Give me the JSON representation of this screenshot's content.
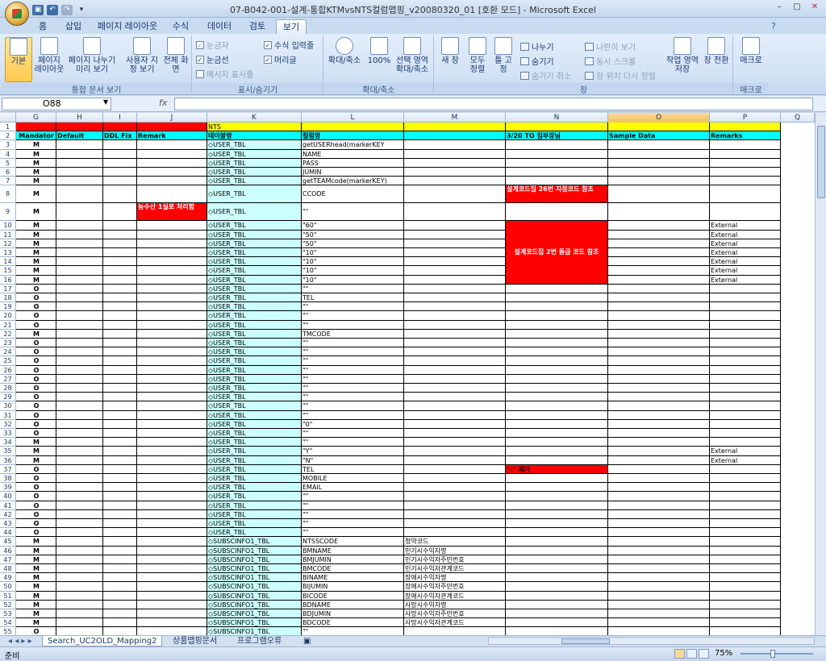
{
  "window": {
    "title": "07-B042-001-설계-통합KTMvsNTS컬럼맵핑_v20080320_01  [호환 모드] - Microsoft Excel",
    "controls": [
      "–",
      "□",
      "✕"
    ]
  },
  "tabs": [
    "홈",
    "삽입",
    "페이지 레이아웃",
    "수식",
    "데이터",
    "검토",
    "보기"
  ],
  "active_tab": "보기",
  "ribbon": {
    "groups": [
      {
        "label": "통합 문서 보기",
        "buttons": [
          "기본",
          "페이지 레이아웃",
          "페이지 나누기 미리 보기",
          "사용자 지정 보기",
          "전체 화면"
        ]
      },
      {
        "label": "표시/숨기기",
        "checks": [
          {
            "label": "눈금자",
            "checked": true,
            "disabled": true
          },
          {
            "label": "수식 입력줄",
            "checked": true,
            "disabled": false
          },
          {
            "label": "눈금선",
            "checked": true,
            "disabled": false
          },
          {
            "label": "머리글",
            "checked": true,
            "disabled": false
          },
          {
            "label": "메시지 표시줄",
            "checked": false,
            "disabled": true
          }
        ]
      },
      {
        "label": "확대/축소",
        "buttons": [
          "확대/축소",
          "100%",
          "선택 영역 확대/축소"
        ]
      },
      {
        "label": "창",
        "buttons": [
          "새 창",
          "모두 정렬",
          "틀 고정"
        ],
        "small": [
          {
            "label": "나누기",
            "disabled": false
          },
          {
            "label": "숨기기",
            "disabled": false
          },
          {
            "label": "숨기기 취소",
            "disabled": true
          },
          {
            "label": "나란히 보기",
            "disabled": true
          },
          {
            "label": "동시 스크롤",
            "disabled": true
          },
          {
            "label": "창 위치 다시 정렬",
            "disabled": true
          }
        ],
        "buttons2": [
          "작업 영역 저장",
          "창 전환"
        ]
      },
      {
        "label": "매크로",
        "buttons": [
          "매크로"
        ]
      }
    ]
  },
  "formula_bar": {
    "name_box": "O88",
    "fx": "fx",
    "value": ""
  },
  "columns": [
    {
      "id": "G",
      "selected": false
    },
    {
      "id": "H",
      "selected": false
    },
    {
      "id": "I",
      "selected": false
    },
    {
      "id": "J",
      "selected": false
    },
    {
      "id": "K",
      "selected": false
    },
    {
      "id": "L",
      "selected": false
    },
    {
      "id": "M",
      "selected": false
    },
    {
      "id": "N",
      "selected": false
    },
    {
      "id": "O",
      "selected": true
    },
    {
      "id": "P",
      "selected": false
    },
    {
      "id": "Q",
      "selected": false
    }
  ],
  "rows": [
    {
      "n": "1",
      "K": "NTS"
    },
    {
      "n": "2",
      "G": "Mandator",
      "H": "Default",
      "I": "DDL Fix",
      "J": "Remark",
      "K": "테이블명",
      "L": "컬럼명",
      "M": "",
      "N": "3/20 TO 임부장님",
      "O": "Sample Data",
      "P": "Remarks"
    },
    {
      "n": "3",
      "G": "M",
      "K": "◇USER_TBL",
      "L": "getUSERhead(markerKEY"
    },
    {
      "n": "4",
      "G": "M",
      "K": "◇USER_TBL",
      "L": "NAME"
    },
    {
      "n": "5",
      "G": "M",
      "K": "◇USER_TBL",
      "L": "PASS"
    },
    {
      "n": "6",
      "G": "M",
      "K": "◇USER_TBL",
      "L": "JUMIN"
    },
    {
      "n": "7",
      "G": "M",
      "K": "◇USER_TBL",
      "L": "getTEAMcode(markerKEY)"
    },
    {
      "n": "8",
      "G": "M",
      "K": "◇USER_TBL",
      "L": "CCODE",
      "N": "설계코드집 26번 지점코드 참조"
    },
    {
      "n": "9",
      "G": "M",
      "J": "농수산 1실로 처리함",
      "K": "◇USER_TBL",
      "L": "\"\""
    },
    {
      "n": "10",
      "G": "M",
      "K": "◇USER_TBL",
      "L": "\"60\"",
      "P": "External"
    },
    {
      "n": "11",
      "G": "M",
      "K": "◇USER_TBL",
      "L": "\"50\"",
      "P": "External"
    },
    {
      "n": "12",
      "G": "M",
      "K": "◇USER_TBL",
      "L": "\"50\"",
      "P": "External"
    },
    {
      "n": "13",
      "G": "M",
      "K": "◇USER_TBL",
      "L": "\"10\"",
      "P": "External"
    },
    {
      "n": "14",
      "G": "M",
      "K": "◇USER_TBL",
      "L": "\"10\"",
      "P": "External"
    },
    {
      "n": "15",
      "G": "M",
      "K": "◇USER_TBL",
      "L": "\"10\"",
      "P": "External"
    },
    {
      "n": "16",
      "G": "M",
      "K": "◇USER_TBL",
      "L": "\"10\"",
      "P": "External"
    },
    {
      "n": "17",
      "G": "O",
      "K": "◇USER_TBL",
      "L": "\"\""
    },
    {
      "n": "18",
      "G": "O",
      "K": "◇USER_TBL",
      "L": "TEL"
    },
    {
      "n": "19",
      "G": "O",
      "K": "◇USER_TBL",
      "L": "\"\""
    },
    {
      "n": "20",
      "G": "O",
      "K": "◇USER_TBL",
      "L": "\"\""
    },
    {
      "n": "21",
      "G": "O",
      "K": "◇USER_TBL",
      "L": "\"\""
    },
    {
      "n": "22",
      "G": "M",
      "K": "◇USER_TBL",
      "L": "TMCODE"
    },
    {
      "n": "23",
      "G": "O",
      "K": "◇USER_TBL",
      "L": "\"\""
    },
    {
      "n": "24",
      "G": "O",
      "K": "◇USER_TBL",
      "L": "\"\""
    },
    {
      "n": "25",
      "G": "O",
      "K": "◇USER_TBL",
      "L": "\"\""
    },
    {
      "n": "26",
      "G": "O",
      "K": "◇USER_TBL",
      "L": "\"\""
    },
    {
      "n": "27",
      "G": "O",
      "K": "◇USER_TBL",
      "L": "\"\""
    },
    {
      "n": "28",
      "G": "O",
      "K": "◇USER_TBL",
      "L": "\"\""
    },
    {
      "n": "29",
      "G": "O",
      "K": "◇USER_TBL",
      "L": "\"\""
    },
    {
      "n": "30",
      "G": "O",
      "K": "◇USER_TBL",
      "L": "\"\""
    },
    {
      "n": "31",
      "G": "O",
      "K": "◇USER_TBL",
      "L": "\"\""
    },
    {
      "n": "32",
      "G": "O",
      "K": "◇USER_TBL",
      "L": "\"0\""
    },
    {
      "n": "33",
      "G": "O",
      "K": "◇USER_TBL",
      "L": "\"\""
    },
    {
      "n": "34",
      "G": "M",
      "K": "◇USER_TBL",
      "L": "\"\""
    },
    {
      "n": "35",
      "G": "M",
      "K": "◇USER_TBL",
      "L": "\"Y\"",
      "P": "External"
    },
    {
      "n": "36",
      "G": "M",
      "K": "◇USER_TBL",
      "L": "\"N\"",
      "P": "External"
    },
    {
      "n": "37",
      "G": "O",
      "K": "◇USER_TBL",
      "L": "TEL",
      "N": "\"-\" 제거"
    },
    {
      "n": "38",
      "G": "O",
      "K": "◇USER_TBL",
      "L": "MOBILE"
    },
    {
      "n": "39",
      "G": "O",
      "K": "◇USER_TBL",
      "L": "EMAIL"
    },
    {
      "n": "40",
      "G": "O",
      "K": "◇USER_TBL",
      "L": "\"\""
    },
    {
      "n": "41",
      "G": "O",
      "K": "◇USER_TBL",
      "L": "\"\""
    },
    {
      "n": "42",
      "G": "O",
      "K": "◇USER_TBL",
      "L": "\"\""
    },
    {
      "n": "43",
      "G": "O",
      "K": "◇USER_TBL",
      "L": "\"\""
    },
    {
      "n": "44",
      "G": "O",
      "K": "◇USER_TBL",
      "L": "\"\""
    },
    {
      "n": "45",
      "G": "M",
      "K": "◇SUBSCINFO1_TBL",
      "L": "NTSSCODE",
      "M": "청약코드"
    },
    {
      "n": "46",
      "G": "M",
      "K": "◇SUBSCINFO1_TBL",
      "L": "BMNAME",
      "M": "민기시수익자명"
    },
    {
      "n": "47",
      "G": "M",
      "K": "◇SUBSCINFO1_TBL",
      "L": "BMJUMIN",
      "M": "민기시수익자주민번호"
    },
    {
      "n": "48",
      "G": "M",
      "K": "◇SUBSCINFO1_TBL",
      "L": "BMCODE",
      "M": "민기시수익자관계코드"
    },
    {
      "n": "49",
      "G": "M",
      "K": "◇SUBSCINFO1_TBL",
      "L": "BINAME",
      "M": "장애시수익자명"
    },
    {
      "n": "50",
      "G": "M",
      "K": "◇SUBSCINFO1_TBL",
      "L": "BIJUMIN",
      "M": "장애시수익자주민번호"
    },
    {
      "n": "51",
      "G": "M",
      "K": "◇SUBSCINFO1_TBL",
      "L": "BICODE",
      "M": "장애시수익자관계코드"
    },
    {
      "n": "52",
      "G": "M",
      "K": "◇SUBSCINFO1_TBL",
      "L": "BDNAME",
      "M": "사망시수익자명"
    },
    {
      "n": "53",
      "G": "M",
      "K": "◇SUBSCINFO1_TBL",
      "L": "BDJUMIN",
      "M": "사망시수익자주민번호"
    },
    {
      "n": "54",
      "G": "M",
      "K": "◇SUBSCINFO1_TBL",
      "L": "BDCODE",
      "M": "사망시수익자관계코드"
    },
    {
      "n": "55",
      "G": "O",
      "K": "◇SUBSCINFO1_TBL",
      "L": "\"\""
    }
  ],
  "merged_notes": {
    "n10_16": "설계코드집 2번 등급 코드 참조"
  },
  "colors": {
    "header_red": "#ff0000",
    "header_yellow": "#ffff00",
    "header_cyan": "#00ffff",
    "k_column": "#ccffff"
  },
  "sheet_tabs": [
    "Search_UC2OLD_Mapping2",
    "상품맵핑문서",
    "프로그램오류"
  ],
  "active_sheet": "Search_UC2OLD_Mapping2",
  "status": {
    "ready": "준비",
    "zoom": "75%"
  }
}
